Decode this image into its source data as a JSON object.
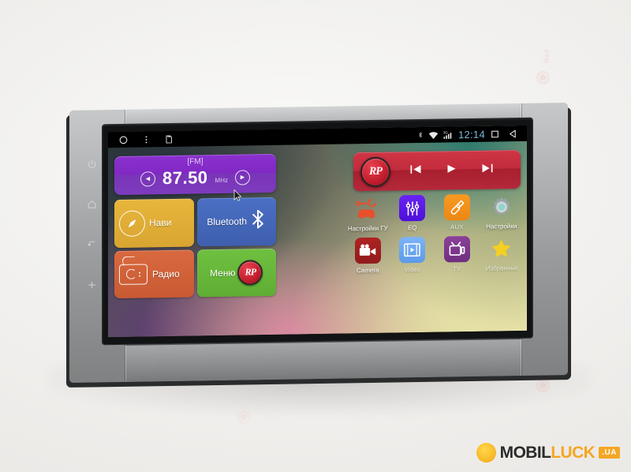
{
  "device": {
    "capacitive_keys": [
      {
        "name": "power-key",
        "glyph": "⏻"
      },
      {
        "name": "home-key",
        "glyph": "⌂"
      },
      {
        "name": "back-key",
        "glyph": "↰"
      },
      {
        "name": "volume-up-key",
        "glyph": "+"
      }
    ]
  },
  "statusbar": {
    "left_icons": [
      {
        "name": "home-circle-icon",
        "glyph": "◯"
      },
      {
        "name": "overflow-menu-icon",
        "glyph": "⋮"
      },
      {
        "name": "sd-card-icon",
        "glyph": "▯"
      }
    ],
    "bluetooth_icon": "bluetooth-icon",
    "wifi_icon": "wifi-icon",
    "signal_icon": "signal-3g-icon",
    "signal_label": "3G",
    "clock": "12:14",
    "recents_icon": "recents-square-icon",
    "back_icon": "back-triangle-icon"
  },
  "fm_widget": {
    "label": "[FM]",
    "frequency": "87.50",
    "unit": "MHz",
    "prev_label": "◀",
    "next_label": "▶",
    "color": "#8028c4"
  },
  "media_widget": {
    "logo_text": "RP",
    "prev_label": "◀◀",
    "play_label": "▶",
    "next_label": "▶▶",
    "color": "#c22c3c"
  },
  "tiles": [
    {
      "name": "tile-navi",
      "label": "Нави",
      "icon": "compass-icon",
      "color": "#d9a531"
    },
    {
      "name": "tile-bluetooth",
      "label": "Bluetooth",
      "icon": "bluetooth-icon",
      "color": "#3f5fae"
    },
    {
      "name": "tile-radio",
      "label": "Радио",
      "icon": "radio-icon",
      "color": "#c85a33"
    },
    {
      "name": "tile-menu",
      "label": "Меню",
      "icon": "rp-logo-icon",
      "color": "#5fae34"
    }
  ],
  "apps": [
    {
      "name": "app-head-unit-settings",
      "label": "Настройки ГУ",
      "icon": "car-wrench-icon",
      "color": "transparent"
    },
    {
      "name": "app-eq",
      "label": "EQ",
      "icon": "equalizer-icon",
      "color": "#5b17e8"
    },
    {
      "name": "app-aux",
      "label": "AUX",
      "icon": "aux-jack-icon",
      "color": "#f0921e"
    },
    {
      "name": "app-settings",
      "label": "Настройки",
      "icon": "gear-icon",
      "color": "transparent"
    },
    {
      "name": "app-camera",
      "label": "Camera",
      "icon": "camcorder-icon",
      "color": "#9d1f1f"
    },
    {
      "name": "app-video",
      "label": "Video",
      "icon": "film-play-icon",
      "color": "#6fa8f0"
    },
    {
      "name": "app-tv",
      "label": "TV",
      "icon": "television-icon",
      "color": "#7b3a8c"
    },
    {
      "name": "app-favorites",
      "label": "Избранные",
      "icon": "star-icon",
      "color": "transparent"
    }
  ],
  "watermark": {
    "word": "Red",
    "dot_glyph": "✿"
  },
  "logo": {
    "part_a": "MOBIL",
    "part_b": "LUCK",
    "domain": ".UA",
    "sun_icon": "sun-mascot-icon"
  }
}
